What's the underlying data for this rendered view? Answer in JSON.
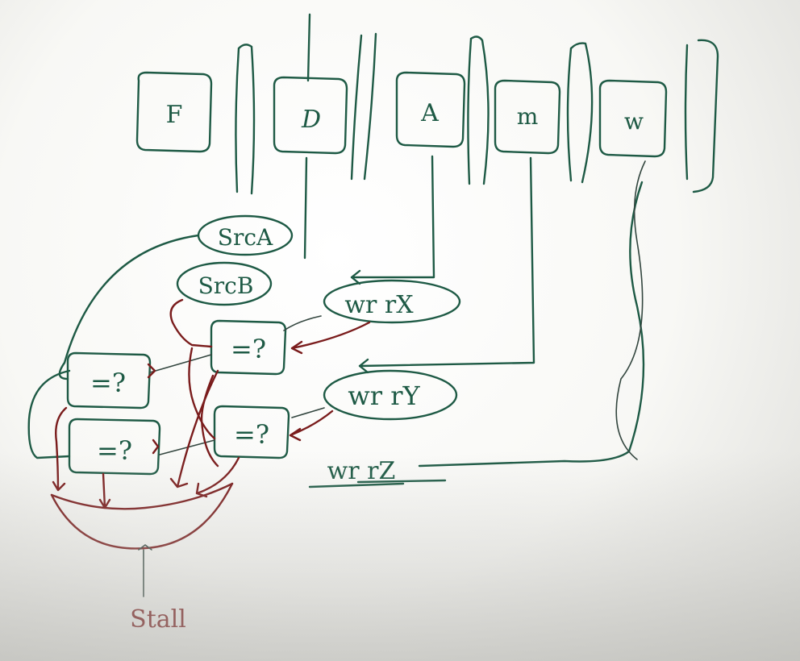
{
  "stages": {
    "fetch": "F",
    "decode": "D",
    "alu": "A",
    "memory": "m",
    "writeback": "w"
  },
  "registers": {
    "src_a": "SrcA",
    "src_b": "SrcB",
    "wr_rx": "wr rX",
    "wr_ry": "wr rY",
    "wr_rz": "wr rZ"
  },
  "comparators": {
    "label": "=?"
  },
  "output": {
    "stall": "Stall"
  }
}
